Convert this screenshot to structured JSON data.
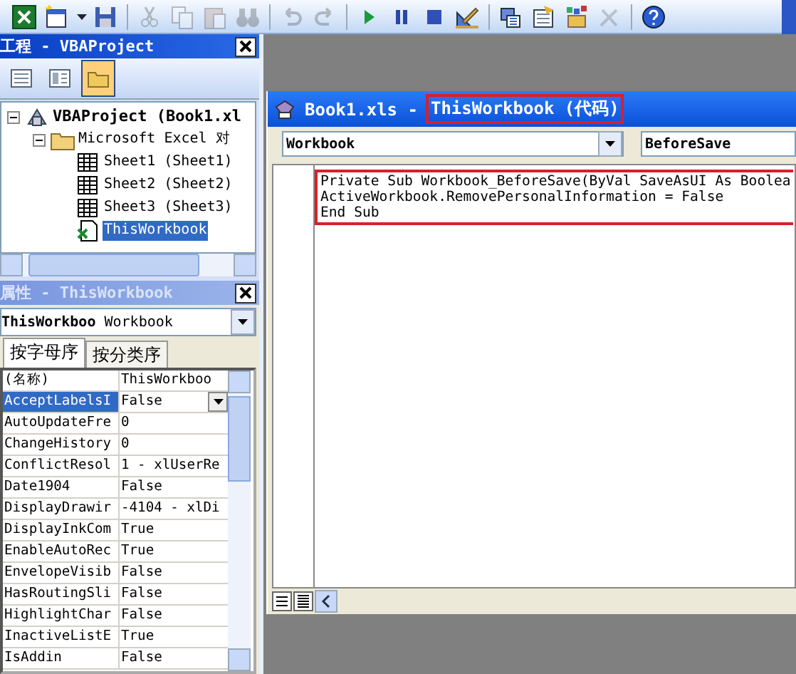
{
  "toolbar": {
    "buttons": [
      {
        "kind": "excel",
        "disabled": false
      },
      {
        "kind": "insert-form",
        "disabled": false
      },
      {
        "kind": "dropdown",
        "disabled": false
      },
      {
        "kind": "save",
        "disabled": false
      },
      {
        "kind": "separator"
      },
      {
        "kind": "cut",
        "disabled": true
      },
      {
        "kind": "copy",
        "disabled": true
      },
      {
        "kind": "paste",
        "disabled": true
      },
      {
        "kind": "find",
        "disabled": true
      },
      {
        "kind": "separator"
      },
      {
        "kind": "undo",
        "disabled": true
      },
      {
        "kind": "redo",
        "disabled": true
      },
      {
        "kind": "separator"
      },
      {
        "kind": "run",
        "disabled": false
      },
      {
        "kind": "pause",
        "disabled": false
      },
      {
        "kind": "stop",
        "disabled": false
      },
      {
        "kind": "design",
        "disabled": false
      },
      {
        "kind": "separator"
      },
      {
        "kind": "project",
        "disabled": false
      },
      {
        "kind": "properties",
        "disabled": false
      },
      {
        "kind": "object-browser",
        "disabled": false
      },
      {
        "kind": "toolbox",
        "disabled": true
      },
      {
        "kind": "separator"
      },
      {
        "kind": "help",
        "disabled": false
      }
    ]
  },
  "project_panel": {
    "title": "工程 - VBAProject",
    "view_buttons": [
      {
        "kind": "view-code",
        "selected": false
      },
      {
        "kind": "view-object",
        "selected": false
      },
      {
        "kind": "toggle-folders",
        "selected": true
      }
    ],
    "tree": [
      {
        "label": "VBAProject (Book1.xl",
        "kind": "project",
        "expanded": true,
        "selected": false,
        "children": [
          {
            "label": "Microsoft Excel 对",
            "kind": "folder",
            "expanded": true,
            "selected": false,
            "children": [
              {
                "label": "Sheet1 (Sheet1)",
                "kind": "sheet",
                "selected": false
              },
              {
                "label": "Sheet2 (Sheet2)",
                "kind": "sheet",
                "selected": false
              },
              {
                "label": "Sheet3 (Sheet3)",
                "kind": "sheet",
                "selected": false
              },
              {
                "label": "ThisWorkbook",
                "kind": "workbook",
                "selected": true
              }
            ]
          }
        ]
      }
    ]
  },
  "properties_panel": {
    "title": "属性 - ThisWorkbook",
    "object": {
      "name": "ThisWorkboo",
      "type": "Workbook"
    },
    "tabs": [
      {
        "label": "按字母序",
        "selected": true
      },
      {
        "label": "按分类序",
        "selected": false
      }
    ],
    "rows": [
      {
        "name": "(名称)",
        "value": "ThisWorkboo",
        "selected": false
      },
      {
        "name": "AcceptLabelsI",
        "value": "False",
        "selected": true
      },
      {
        "name": "AutoUpdateFre",
        "value": "0",
        "selected": false
      },
      {
        "name": "ChangeHistory",
        "value": "0",
        "selected": false
      },
      {
        "name": "ConflictResol",
        "value": "1 - xlUserRe",
        "selected": false
      },
      {
        "name": "Date1904",
        "value": "False",
        "selected": false
      },
      {
        "name": "DisplayDrawir",
        "value": "-4104 - xlDi",
        "selected": false
      },
      {
        "name": "DisplayInkCom",
        "value": "True",
        "selected": false
      },
      {
        "name": "EnableAutoRec",
        "value": "True",
        "selected": false
      },
      {
        "name": "EnvelopeVisib",
        "value": "False",
        "selected": false
      },
      {
        "name": "HasRoutingSli",
        "value": "False",
        "selected": false
      },
      {
        "name": "HighlightChar",
        "value": "False",
        "selected": false
      },
      {
        "name": "InactiveListE",
        "value": "True",
        "selected": false
      },
      {
        "name": "IsAddin",
        "value": "False",
        "selected": false
      }
    ]
  },
  "code_window": {
    "title_parts": [
      {
        "text": "Book1.xls -",
        "highlighted": false
      },
      {
        "text": "ThisWorkbook (代码)",
        "highlighted": true
      }
    ],
    "object": "Workbook",
    "procedure": "BeforeSave",
    "code": {
      "highlighted": true,
      "lines": [
        "Private Sub Workbook_BeforeSave(ByVal SaveAsUI As Boolea",
        "ActiveWorkbook.RemovePersonalInformation = False",
        "End Sub"
      ]
    }
  }
}
